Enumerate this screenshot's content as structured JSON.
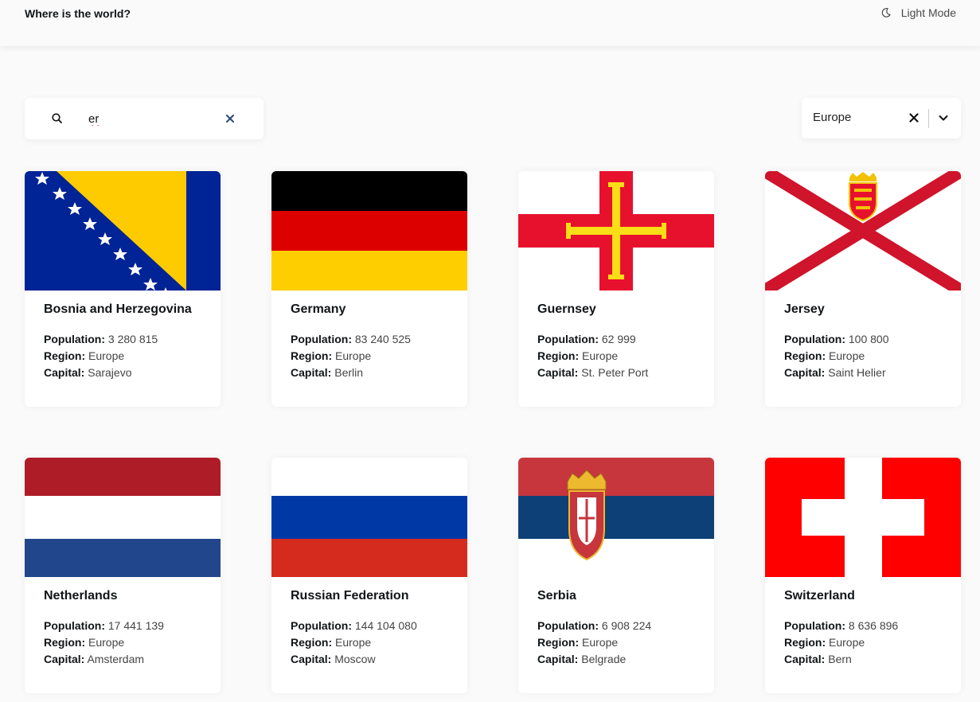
{
  "header": {
    "title": "Where is the world?",
    "mode_label": "Light Mode"
  },
  "search": {
    "value": "er"
  },
  "filter": {
    "selected": "Europe"
  },
  "labels": {
    "population": "Population:",
    "region": "Region:",
    "capital": "Capital:"
  },
  "countries": [
    {
      "name": "Bosnia and Herzegovina",
      "population": "3 280 815",
      "region": "Europe",
      "capital": "Sarajevo"
    },
    {
      "name": "Germany",
      "population": "83 240 525",
      "region": "Europe",
      "capital": "Berlin"
    },
    {
      "name": "Guernsey",
      "population": "62 999",
      "region": "Europe",
      "capital": "St. Peter Port"
    },
    {
      "name": "Jersey",
      "population": "100 800",
      "region": "Europe",
      "capital": "Saint Helier"
    },
    {
      "name": "Netherlands",
      "population": "17 441 139",
      "region": "Europe",
      "capital": "Amsterdam"
    },
    {
      "name": "Russian Federation",
      "population": "144 104 080",
      "region": "Europe",
      "capital": "Moscow"
    },
    {
      "name": "Serbia",
      "population": "6 908 224",
      "region": "Europe",
      "capital": "Belgrade"
    },
    {
      "name": "Switzerland",
      "population": "8 636 896",
      "region": "Europe",
      "capital": "Bern"
    }
  ]
}
